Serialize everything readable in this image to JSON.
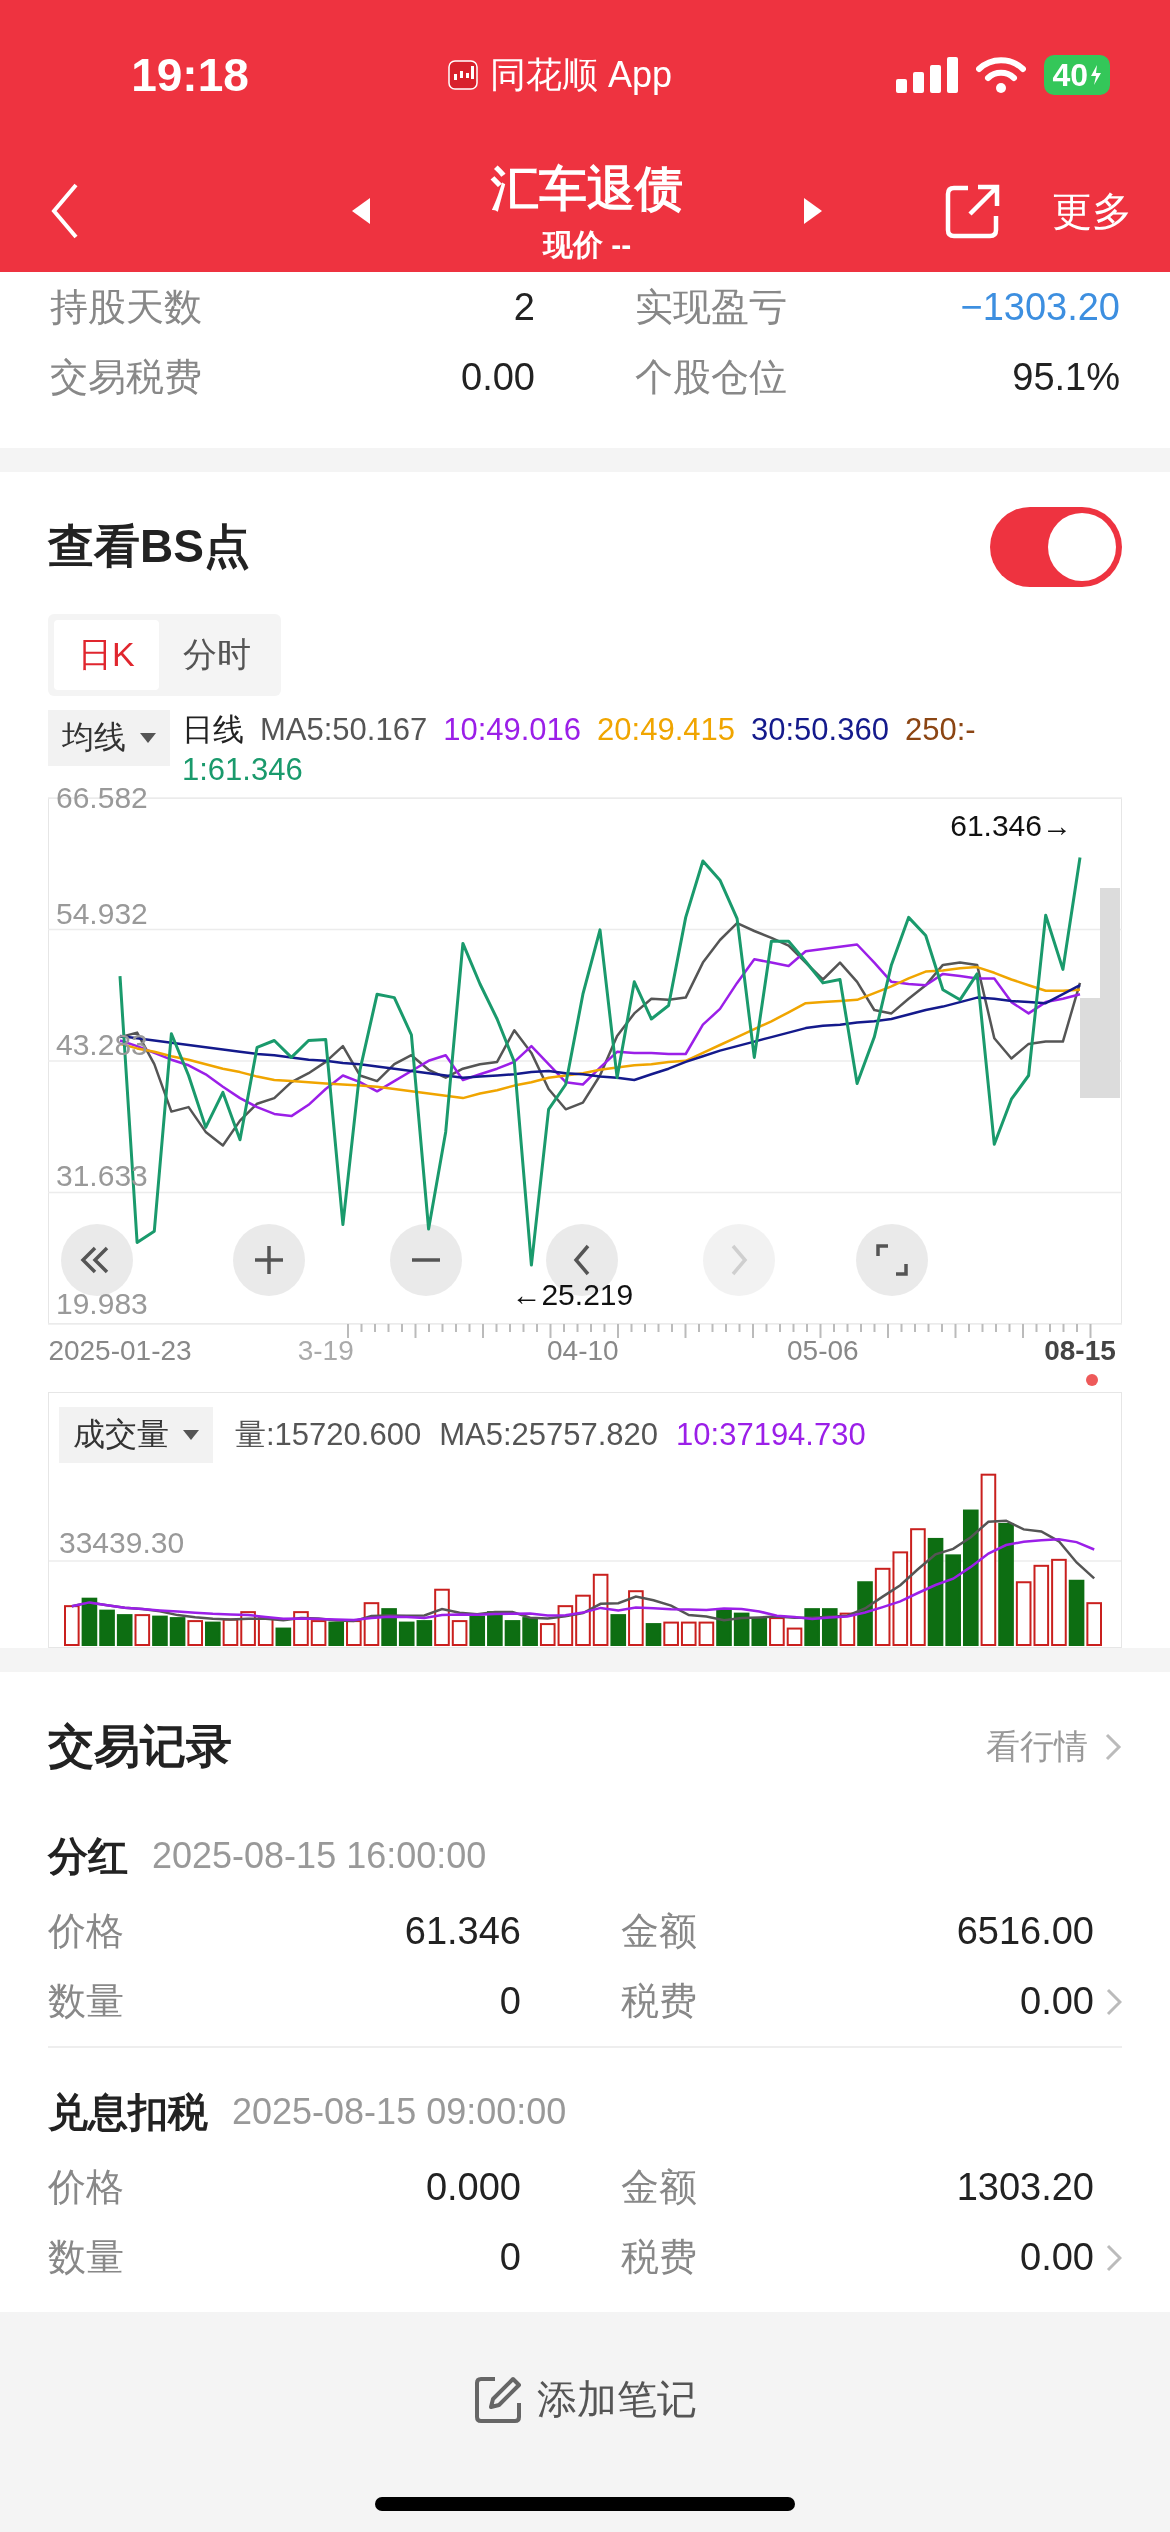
{
  "status_bar": {
    "time": "19:18",
    "app": "同花顺 App",
    "battery": "40"
  },
  "header": {
    "title": "汇车退债",
    "subtitle": "现价 --",
    "more": "更多"
  },
  "summary": [
    {
      "label": "持股天数",
      "value": "2",
      "color": "#222222"
    },
    {
      "label": "实现盈亏",
      "value": "−1303.20",
      "color": "#3d8fe0"
    },
    {
      "label": "交易税费",
      "value": "0.00",
      "color": "#222222"
    },
    {
      "label": "个股仓位",
      "value": "95.1%",
      "color": "#222222"
    }
  ],
  "bs_points": {
    "label": "查看BS点",
    "on": true
  },
  "chart_tabs": [
    {
      "label": "日K",
      "selected": true
    },
    {
      "label": "分时",
      "selected": false
    }
  ],
  "indicator": "均线",
  "legend": [
    [
      {
        "text": "日线",
        "color": "#222222"
      },
      {
        "text": "MA5:50.167",
        "color": "#555555"
      },
      {
        "text": "10:49.016",
        "color": "#9b1fe8"
      },
      {
        "text": "20:49.415",
        "color": "#f0a500"
      },
      {
        "text": "30:50.360",
        "color": "#141a8c"
      },
      {
        "text": "250:-",
        "color": "#8b4513"
      }
    ],
    [
      {
        "text": "1:61.346",
        "color": "#1a9a6c"
      }
    ]
  ],
  "price_chart": {
    "chart_data": {
      "type": "line",
      "categories": [
        "2025-01-23",
        null,
        null,
        null,
        null,
        null,
        null,
        null,
        null,
        null,
        null,
        null,
        "3-19",
        null,
        null,
        null,
        null,
        null,
        null,
        null,
        null,
        null,
        null,
        null,
        null,
        null,
        null,
        "04-10",
        null,
        null,
        null,
        null,
        null,
        null,
        null,
        null,
        null,
        null,
        null,
        null,
        null,
        "05-06",
        null,
        null,
        null,
        null,
        null,
        null,
        null,
        null,
        null,
        null,
        null,
        null,
        null,
        null,
        "08-15"
      ],
      "ylim": [
        19.983,
        66.582
      ],
      "yticks": [
        {
          "value": 66.582,
          "label": "66.582"
        },
        {
          "value": 54.932,
          "label": "54.932"
        },
        {
          "value": 43.283,
          "label": "43.283"
        },
        {
          "value": 31.633,
          "label": "31.633"
        },
        {
          "value": 19.983,
          "label": "19.983"
        }
      ],
      "series": [
        {
          "color": "#555555",
          "values": [
            45.4,
            45.8,
            43.0,
            38.8,
            39.2,
            37.0,
            35.8,
            38.0,
            39.5,
            40.0,
            41.4,
            42.2,
            43.2,
            44.6,
            42.0,
            41.5,
            43.0,
            43.8,
            42.5,
            41.8,
            42.6,
            43.0,
            43.2,
            46.0,
            44.0,
            40.8,
            39.0,
            39.6,
            42.0,
            45.5,
            47.5,
            48.8,
            48.7,
            48.9,
            52.0,
            54.0,
            55.5,
            54.8,
            54.2,
            53.5,
            52.0,
            50.5,
            52.0,
            50.3,
            47.8,
            47.5,
            48.8,
            50.0,
            51.8,
            52.0,
            51.8,
            45.3,
            43.5,
            44.8,
            45.0,
            45.0,
            50.2
          ]
        },
        {
          "color": "#9b1fe8",
          "values": [
            45.1,
            44.6,
            44.0,
            43.4,
            42.9,
            42.1,
            41.0,
            40.0,
            39.2,
            38.6,
            38.4,
            39.4,
            40.8,
            42.0,
            41.4,
            40.6,
            41.5,
            42.4,
            43.3,
            43.8,
            41.6,
            42.1,
            42.6,
            43.2,
            44.6,
            43.0,
            41.4,
            41.2,
            42.7,
            44.1,
            44.0,
            44.0,
            43.9,
            43.9,
            46.5,
            47.9,
            50.2,
            52.3,
            52.0,
            51.7,
            53.0,
            53.2,
            53.4,
            53.6,
            52.0,
            50.3,
            50.1,
            50.0,
            51.0,
            50.8,
            50.6,
            50.6,
            48.5,
            47.5,
            48.5,
            48.8,
            49.2
          ]
        },
        {
          "color": "#f0a500",
          "values": [
            44.8,
            44.4,
            44.1,
            43.7,
            43.4,
            43.0,
            42.6,
            42.3,
            41.9,
            41.6,
            41.5,
            41.4,
            41.3,
            41.2,
            41.1,
            41.0,
            40.8,
            40.6,
            40.4,
            40.2,
            40.0,
            40.4,
            40.7,
            41.1,
            41.4,
            41.8,
            42.0,
            42.2,
            42.5,
            42.7,
            42.9,
            43.0,
            43.2,
            43.3,
            44.0,
            44.7,
            45.4,
            46.1,
            46.8,
            47.6,
            48.4,
            48.5,
            48.6,
            48.7,
            49.3,
            49.9,
            50.6,
            51.2,
            51.3,
            51.5,
            51.6,
            51.1,
            50.5,
            50.0,
            49.5,
            49.5,
            49.6
          ]
        },
        {
          "color": "#141a8c",
          "values": [
            45.5,
            45.3,
            45.1,
            44.9,
            44.7,
            44.5,
            44.3,
            44.1,
            43.9,
            43.8,
            43.6,
            43.4,
            43.3,
            43.1,
            43.0,
            42.8,
            42.6,
            42.4,
            42.2,
            42.0,
            41.8,
            41.9,
            42.0,
            42.1,
            42.3,
            42.4,
            42.2,
            42.1,
            41.9,
            41.8,
            41.6,
            42.1,
            42.6,
            43.2,
            43.7,
            44.2,
            44.6,
            45.0,
            45.4,
            45.8,
            46.2,
            46.4,
            46.5,
            46.7,
            46.8,
            47.0,
            47.4,
            47.8,
            48.1,
            48.5,
            48.9,
            48.8,
            48.6,
            48.5,
            48.4,
            49.2,
            50.0
          ]
        },
        {
          "color": "#1a9a6c",
          "values": [
            50.8,
            27.2,
            28.2,
            45.7,
            42.0,
            37.4,
            40.5,
            36.3,
            44.5,
            45.1,
            43.6,
            45.1,
            45.2,
            28.8,
            42.5,
            49.2,
            48.9,
            45.6,
            28.4,
            37.0,
            53.7,
            50.1,
            47.0,
            43.2,
            25.2,
            39.0,
            41.2,
            49.2,
            54.9,
            41.8,
            50.3,
            47.0,
            48.2,
            56.0,
            61.0,
            59.3,
            55.9,
            43.6,
            53.9,
            53.9,
            52.1,
            50.2,
            50.5,
            41.3,
            45.4,
            51.8,
            56.0,
            54.4,
            49.6,
            48.7,
            51.0,
            35.9,
            39.9,
            42.0,
            56.2,
            51.4,
            61.3
          ]
        }
      ],
      "annotations": [
        "61.346→",
        "←25.219"
      ],
      "grid": true
    },
    "controls": [
      {
        "kind": "first",
        "disabled": false
      },
      {
        "kind": "zoom_in",
        "disabled": false
      },
      {
        "kind": "zoom_out",
        "disabled": false
      },
      {
        "kind": "prev",
        "disabled": false
      },
      {
        "kind": "next",
        "disabled": true
      },
      {
        "kind": "fullscreen",
        "disabled": false
      }
    ]
  },
  "volume": {
    "indicator": "成交量",
    "legend": [
      {
        "text": "量:15720.600",
        "color": "#555555"
      },
      {
        "text": "MA5:25757.820",
        "color": "#555555"
      },
      {
        "text": "10:37194.730",
        "color": "#9b1fe8"
      }
    ],
    "tick": "33439.30"
  },
  "trade_records": {
    "title": "交易记录",
    "link": "看行情",
    "records": [
      {
        "type": "分红",
        "time": "2025-08-15 16:00:00",
        "fields": [
          {
            "label": "价格",
            "value": "61.346"
          },
          {
            "label": "金额",
            "value": "6516.00"
          },
          {
            "label": "数量",
            "value": "0"
          },
          {
            "label": "税费",
            "value": "0.00"
          }
        ]
      },
      {
        "type": "兑息扣税",
        "time": "2025-08-15 09:00:00",
        "fields": [
          {
            "label": "价格",
            "value": "0.000"
          },
          {
            "label": "金额",
            "value": "1303.20"
          },
          {
            "label": "数量",
            "value": "0"
          },
          {
            "label": "税费",
            "value": "0.00"
          }
        ]
      }
    ]
  },
  "add_note": "添加笔记"
}
